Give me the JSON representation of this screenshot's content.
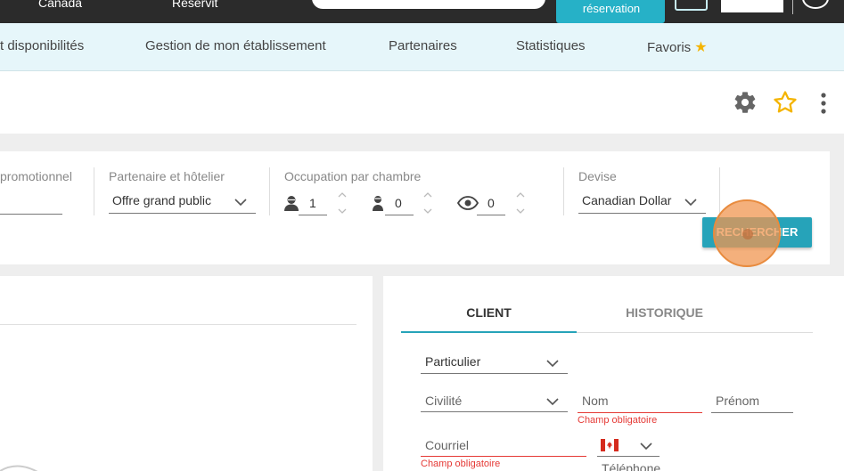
{
  "topbar": {
    "left_text": "Canada",
    "mid_text": "Reservit",
    "reserve_button": "réservation"
  },
  "nav": {
    "items": [
      {
        "label": "t disponibilités"
      },
      {
        "label": "Gestion de mon établissement"
      },
      {
        "label": "Partenaires"
      },
      {
        "label": "Statistiques"
      },
      {
        "label": "Favoris"
      }
    ]
  },
  "search": {
    "promo_label": "promotionnel",
    "partner_label": "Partenaire et hôtelier",
    "partner_value": "Offre grand public",
    "occupancy_label": "Occupation par chambre",
    "adults": "1",
    "children": "0",
    "infants": "0",
    "currency_label": "Devise",
    "currency_value": "Canadian Dollar",
    "search_button": "RECHERCHER"
  },
  "client_panel": {
    "tabs": [
      {
        "label": "CLIENT",
        "active": true
      },
      {
        "label": "HISTORIQUE",
        "active": false
      }
    ],
    "client_type": "Particulier",
    "civility_placeholder": "Civilité",
    "name_placeholder": "Nom",
    "firstname_placeholder": "Prénom",
    "email_placeholder": "Courriel",
    "phone_placeholder": "Téléphone",
    "required_msg": "Champ obligatoire"
  },
  "colors": {
    "accent": "#26a3b9",
    "error": "#e53935",
    "star": "#f4b400"
  }
}
